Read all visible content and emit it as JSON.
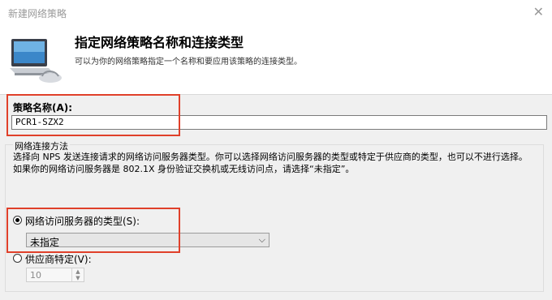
{
  "window": {
    "title": "新建网络策略",
    "close_glyph": "✕"
  },
  "header": {
    "title": "指定网络策略名称和连接类型",
    "subtitle": "可以为你的网络策略指定一个名称和要应用该策略的连接类型。",
    "icon": "network-policy-icon"
  },
  "policy_name": {
    "label": "策略名称(A):",
    "value": "PCR1-SZX2"
  },
  "connection_method": {
    "group_title": "网络连接方法",
    "description": "选择向 NPS 发送连接请求的网络访问服务器类型。你可以选择网络访问服务器的类型或特定于供应商的类型，也可以不进行选择。如果你的网络访问服务器是 802.1X 身份验证交换机或无线访问点，请选择“未指定”。",
    "type_option": {
      "label": "网络访问服务器的类型(S):",
      "checked": true
    },
    "type_select": {
      "value": "未指定"
    },
    "vendor_option": {
      "label": "供应商特定(V):",
      "checked": false
    },
    "vendor_spinner": {
      "value": "10"
    }
  },
  "highlight_color": "#e0402a"
}
